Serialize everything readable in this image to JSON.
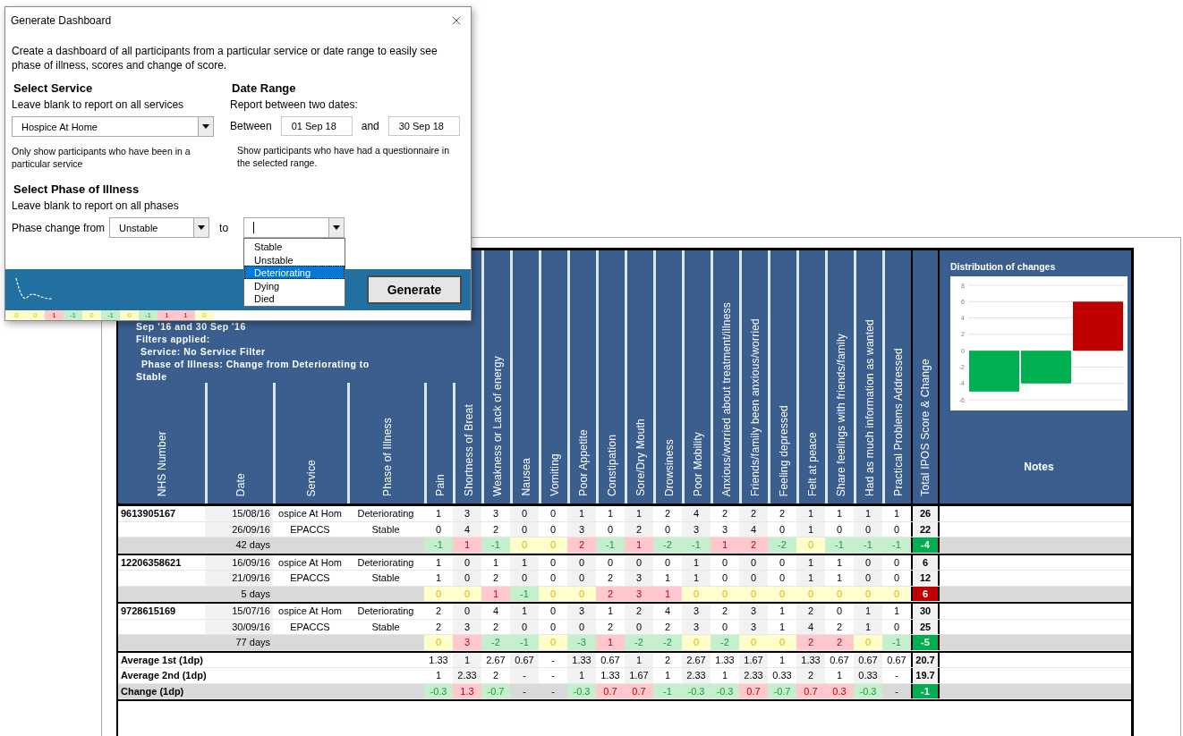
{
  "dialog": {
    "title": "Generate Dashboard",
    "intro": "Create a dashboard of all participants from a particular service or date range to easily see phase of illness, scores and change of score.",
    "service": {
      "heading": "Select Service",
      "hint": "Leave blank to report on all services",
      "value": "Hospice At Home",
      "note": "Only show participants who have been in a particular service"
    },
    "date_range": {
      "heading": "Date Range",
      "hint": "Report between two dates:",
      "between_label": "Between",
      "from": "01 Sep 18",
      "and_label": "and",
      "to": "30 Sep 18",
      "note": "Show participants who have had a questionnaire in the selected range."
    },
    "phase": {
      "heading": "Select Phase of Illness",
      "hint": "Leave blank to report on all phases",
      "from_label": "Phase change from",
      "from_value": "Unstable",
      "to_label": "to",
      "to_expanded": true,
      "options": [
        {
          "label": "Stable",
          "selected": false
        },
        {
          "label": "Unstable",
          "selected": false
        },
        {
          "label": "Deteriorating",
          "selected": true
        },
        {
          "label": "Dying",
          "selected": false
        },
        {
          "label": "Died",
          "selected": false
        }
      ]
    },
    "generate_button": "Generate",
    "peek_row": [
      {
        "value": "0",
        "color": "#ffffcc"
      },
      {
        "value": "0",
        "color": "#ffffcc"
      },
      {
        "value": "1",
        "color": "#ffc7ce"
      },
      {
        "value": "-1",
        "color": "#c6efce"
      },
      {
        "value": "0",
        "color": "#ffffcc"
      },
      {
        "value": "-1",
        "color": "#c6efce"
      },
      {
        "value": "0",
        "color": "#ffffcc"
      },
      {
        "value": "-1",
        "color": "#c6efce"
      },
      {
        "value": "1",
        "color": "#ffc7ce"
      },
      {
        "value": "1",
        "color": "#ffc7ce"
      },
      {
        "value": "0",
        "color": "#ffffcc"
      }
    ]
  },
  "report": {
    "header_lines": [
      "Sep '16 and 30 Sep '16",
      "Filters applied:",
      "Service: No Service Filter",
      "Phase of Illness: Change from Deteriorating to",
      "Stable"
    ],
    "columns": {
      "info": [
        "NHS Number",
        "Date",
        "Service",
        "Phase of Illness"
      ],
      "items": [
        "Pain",
        "Shortness of Breat",
        "Weakness or Lack of energy",
        "Nausea",
        "Vomiting",
        "Poor Appetite",
        "Constipation",
        "Sore/Dry Mouth",
        "Drowsiness",
        "Poor Mobility",
        "Anxious/worried about treatment/illness",
        "Friends/family been anxious/worried",
        "Feeling depressed",
        "Felt at peace",
        "Share feelings with friends/family",
        "Had as much information as wanted",
        "Practical Problems Addressed"
      ],
      "total": "Total IPOS Score & Change",
      "notes": "Notes"
    },
    "chart": {
      "chart_data": {
        "type": "bar",
        "title": "Distribution of changes",
        "values": [
          -5,
          -4,
          6
        ],
        "ylim": [
          -6,
          8
        ],
        "yticks": [
          -6,
          -4,
          -2,
          0,
          2,
          4,
          6,
          8
        ],
        "grid": true
      }
    },
    "participants": [
      {
        "nhs_number": "9613905167",
        "visits": [
          {
            "date": "15/08/16",
            "service": "ospice At Hom",
            "phase": "Deteriorating",
            "scores": [
              "1",
              "3",
              "3",
              "0",
              "0",
              "1",
              "1",
              "1",
              "2",
              "4",
              "2",
              "2",
              "2",
              "1",
              "1",
              "1",
              "1"
            ],
            "total": "26"
          },
          {
            "date": "26/09/16",
            "service": "EPACCS",
            "phase": "Stable",
            "scores": [
              "0",
              "4",
              "2",
              "0",
              "0",
              "3",
              "0",
              "2",
              "0",
              "3",
              "3",
              "4",
              "0",
              "1",
              "0",
              "0",
              "0"
            ],
            "total": "22"
          }
        ],
        "change": {
          "interval": "42 days",
          "scores": [
            {
              "value": "-1",
              "color": "#c6efce"
            },
            {
              "value": "1",
              "color": "#ffc7ce"
            },
            {
              "value": "-1",
              "color": "#c6efce"
            },
            {
              "value": "0",
              "color": "#ffffcc"
            },
            {
              "value": "0",
              "color": "#ffffcc"
            },
            {
              "value": "2",
              "color": "#ffc7ce"
            },
            {
              "value": "-1",
              "color": "#c6efce"
            },
            {
              "value": "1",
              "color": "#ffc7ce"
            },
            {
              "value": "-2",
              "color": "#c6efce"
            },
            {
              "value": "-1",
              "color": "#c6efce"
            },
            {
              "value": "1",
              "color": "#ffc7ce"
            },
            {
              "value": "2",
              "color": "#ffc7ce"
            },
            {
              "value": "-2",
              "color": "#c6efce"
            },
            {
              "value": "0",
              "color": "#ffffcc"
            },
            {
              "value": "-1",
              "color": "#c6efce"
            },
            {
              "value": "-1",
              "color": "#c6efce"
            },
            {
              "value": "-1",
              "color": "#c6efce"
            }
          ],
          "total": {
            "value": "-4",
            "color": "#00b050"
          }
        }
      },
      {
        "nhs_number": "12206358621",
        "visits": [
          {
            "date": "16/09/16",
            "service": "ospice At Hom",
            "phase": "Deteriorating",
            "scores": [
              "1",
              "0",
              "1",
              "1",
              "0",
              "0",
              "0",
              "0",
              "0",
              "1",
              "0",
              "0",
              "0",
              "1",
              "1",
              "0",
              "0"
            ],
            "total": "6"
          },
          {
            "date": "21/09/16",
            "service": "EPACCS",
            "phase": "Stable",
            "scores": [
              "1",
              "0",
              "2",
              "0",
              "0",
              "0",
              "2",
              "3",
              "1",
              "1",
              "0",
              "0",
              "0",
              "1",
              "1",
              "0",
              "0"
            ],
            "total": "12"
          }
        ],
        "change": {
          "interval": "5 days",
          "scores": [
            {
              "value": "0",
              "color": "#ffffcc"
            },
            {
              "value": "0",
              "color": "#ffffcc"
            },
            {
              "value": "1",
              "color": "#ffc7ce"
            },
            {
              "value": "-1",
              "color": "#c6efce"
            },
            {
              "value": "0",
              "color": "#ffffcc"
            },
            {
              "value": "0",
              "color": "#ffffcc"
            },
            {
              "value": "2",
              "color": "#ffc7ce"
            },
            {
              "value": "3",
              "color": "#ffc7ce"
            },
            {
              "value": "1",
              "color": "#ffc7ce"
            },
            {
              "value": "0",
              "color": "#ffffcc"
            },
            {
              "value": "0",
              "color": "#ffffcc"
            },
            {
              "value": "0",
              "color": "#ffffcc"
            },
            {
              "value": "0",
              "color": "#ffffcc"
            },
            {
              "value": "0",
              "color": "#ffffcc"
            },
            {
              "value": "0",
              "color": "#ffffcc"
            },
            {
              "value": "0",
              "color": "#ffffcc"
            },
            {
              "value": "0",
              "color": "#ffffcc"
            }
          ],
          "total": {
            "value": "6",
            "color": "#c00000"
          }
        }
      },
      {
        "nhs_number": "9728615169",
        "visits": [
          {
            "date": "15/07/16",
            "service": "ospice At Hom",
            "phase": "Deteriorating",
            "scores": [
              "2",
              "0",
              "4",
              "1",
              "0",
              "3",
              "1",
              "2",
              "4",
              "3",
              "2",
              "3",
              "1",
              "2",
              "0",
              "1",
              "1"
            ],
            "total": "30"
          },
          {
            "date": "30/09/16",
            "service": "EPACCS",
            "phase": "Stable",
            "scores": [
              "2",
              "3",
              "2",
              "0",
              "0",
              "0",
              "2",
              "0",
              "2",
              "3",
              "0",
              "3",
              "1",
              "4",
              "2",
              "1",
              "0"
            ],
            "total": "25"
          }
        ],
        "change": {
          "interval": "77 days",
          "scores": [
            {
              "value": "0",
              "color": "#ffffcc"
            },
            {
              "value": "3",
              "color": "#ffc7ce"
            },
            {
              "value": "-2",
              "color": "#c6efce"
            },
            {
              "value": "-1",
              "color": "#c6efce"
            },
            {
              "value": "0",
              "color": "#ffffcc"
            },
            {
              "value": "-3",
              "color": "#c6efce"
            },
            {
              "value": "1",
              "color": "#ffc7ce"
            },
            {
              "value": "-2",
              "color": "#c6efce"
            },
            {
              "value": "-2",
              "color": "#c6efce"
            },
            {
              "value": "0",
              "color": "#ffffcc"
            },
            {
              "value": "-2",
              "color": "#c6efce"
            },
            {
              "value": "0",
              "color": "#ffffcc"
            },
            {
              "value": "0",
              "color": "#ffffcc"
            },
            {
              "value": "2",
              "color": "#ffc7ce"
            },
            {
              "value": "2",
              "color": "#ffc7ce"
            },
            {
              "value": "0",
              "color": "#ffffcc"
            },
            {
              "value": "-1",
              "color": "#c6efce"
            }
          ],
          "total": {
            "value": "-5",
            "color": "#00b050"
          }
        }
      }
    ],
    "averages": [
      {
        "label": "Average 1st (1dp)",
        "values": [
          "1.33",
          "1",
          "2.67",
          "0.67",
          "-",
          "1.33",
          "0.67",
          "1",
          "2",
          "2.67",
          "1.33",
          "1.67",
          "1",
          "1.33",
          "0.67",
          "0.67",
          "0.67"
        ],
        "total": "20.7"
      },
      {
        "label": "Average 2nd (1dp)",
        "values": [
          "1",
          "2.33",
          "2",
          "-",
          "-",
          "1",
          "1.33",
          "1.67",
          "1",
          "2.33",
          "1",
          "2.33",
          "0.33",
          "2",
          "1",
          "0.33",
          "-"
        ],
        "total": "19.7"
      }
    ],
    "change_summary": {
      "label": "Change (1dp)",
      "values": [
        {
          "value": "-0.3",
          "color": "#c6efce"
        },
        {
          "value": "1.3",
          "color": "#ffc7ce"
        },
        {
          "value": "-0.7",
          "color": "#c6efce"
        },
        {
          "value": "-"
        },
        {
          "value": "-"
        },
        {
          "value": "-0.3",
          "color": "#c6efce"
        },
        {
          "value": "0.7",
          "color": "#ffc7ce"
        },
        {
          "value": "0.7",
          "color": "#ffc7ce"
        },
        {
          "value": "-1",
          "color": "#c6efce"
        },
        {
          "value": "-0.3",
          "color": "#c6efce"
        },
        {
          "value": "-0.3",
          "color": "#c6efce"
        },
        {
          "value": "0.7",
          "color": "#ffc7ce"
        },
        {
          "value": "-0.7",
          "color": "#c6efce"
        },
        {
          "value": "0.7",
          "color": "#ffc7ce"
        },
        {
          "value": "0.3",
          "color": "#ffc7ce"
        },
        {
          "value": "-0.3",
          "color": "#c6efce"
        },
        {
          "value": "-"
        }
      ],
      "total": {
        "value": "-1",
        "color": "#00b050"
      }
    }
  }
}
